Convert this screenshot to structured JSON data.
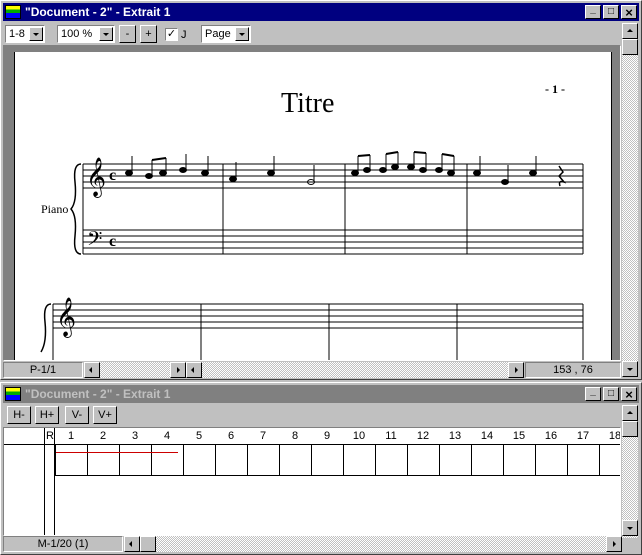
{
  "score_window": {
    "title": "\"Document - 2\" - Extrait 1",
    "toolbar": {
      "staff_range": "1-8",
      "zoom": "100 %",
      "zoom_out_label": "-",
      "zoom_in_label": "+",
      "justify_checked": true,
      "justify_label": "J",
      "view_mode": "Page"
    },
    "page": {
      "title": "Titre",
      "page_number": "- 1 -",
      "instrument": "Piano"
    },
    "status": {
      "page_indicator": "P-1/1",
      "coordinates": "153 , 76"
    }
  },
  "grid_window": {
    "title": "\"Document - 2\" - Extrait 1",
    "toolbar": {
      "h_minus": "H-",
      "h_plus": "H+",
      "v_minus": "V-",
      "v_plus": "V+"
    },
    "row_header": "R",
    "measures": [
      "1",
      "2",
      "3",
      "4",
      "5",
      "6",
      "7",
      "8",
      "9",
      "10",
      "11",
      "12",
      "13",
      "14",
      "15",
      "16",
      "17",
      "18"
    ],
    "status": {
      "measure_indicator": "M-1/20 (1)"
    }
  },
  "window_buttons": {
    "minimize": "_",
    "maximize": "□",
    "close": "×"
  },
  "colors": {
    "active_title": "#000080",
    "inactive_title": "#808080",
    "grid_note_line": "#cc0000"
  }
}
